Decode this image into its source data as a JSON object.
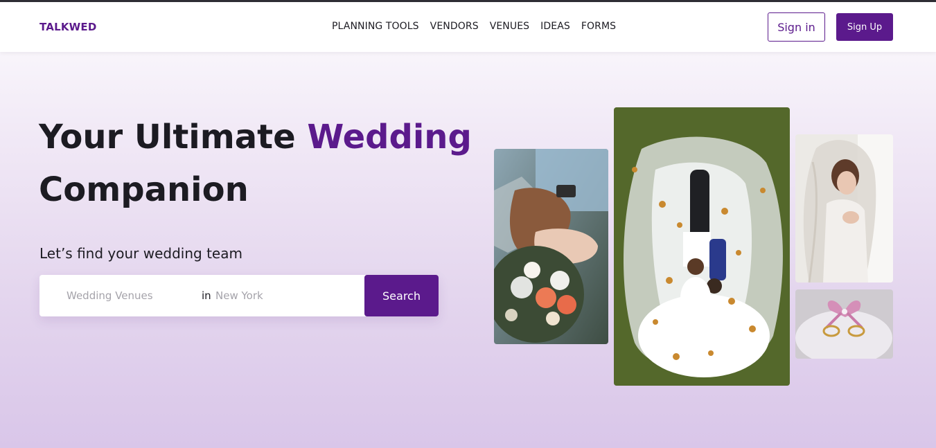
{
  "brand": {
    "logo": "TALKWED",
    "accent_color": "#5b1a8c"
  },
  "nav": {
    "items": [
      {
        "label": "PLANNING TOOLS"
      },
      {
        "label": "VENDORS"
      },
      {
        "label": "VENUES"
      },
      {
        "label": "IDEAS"
      },
      {
        "label": "FORMS"
      }
    ]
  },
  "auth": {
    "signin_label": "Sign in",
    "signup_label": "Sign Up"
  },
  "hero": {
    "title_prefix": "Your Ultimate ",
    "title_accent": "Wedding",
    "title_suffix": "Companion",
    "subtitle": "Let’s find your wedding team"
  },
  "search": {
    "what_placeholder": "Wedding Venues",
    "what_value": "",
    "in_label": "in",
    "where_placeholder": "New York",
    "where_value": "",
    "button_label": "Search"
  },
  "gallery": {
    "photos": [
      {
        "name": "hands-bouquet-photo"
      },
      {
        "name": "couple-lying-on-grass-photo"
      },
      {
        "name": "bride-veil-photo"
      },
      {
        "name": "rings-pillow-photo"
      }
    ]
  }
}
